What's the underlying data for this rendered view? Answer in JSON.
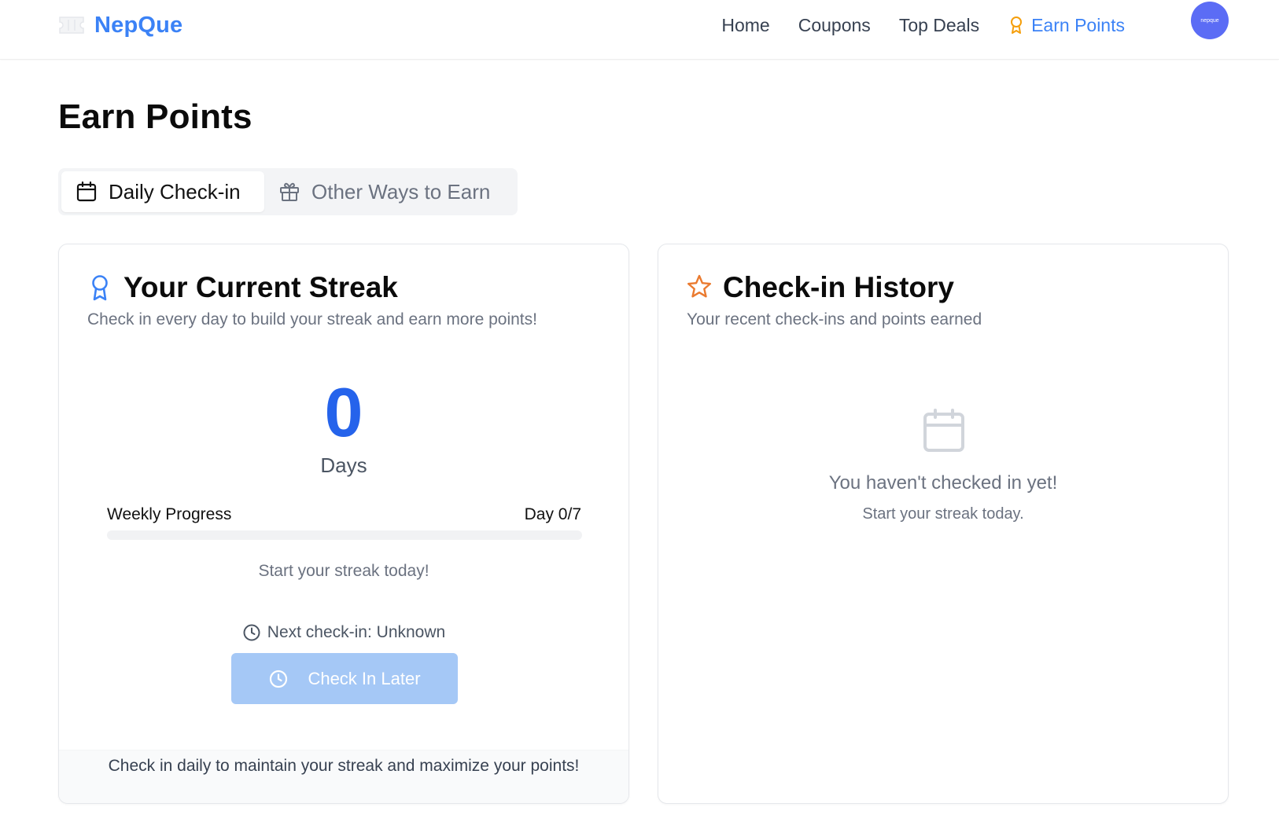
{
  "header": {
    "brand": "NepQue",
    "brand_icon": "ticket-icon",
    "nav": [
      {
        "label": "Home",
        "active": false
      },
      {
        "label": "Coupons",
        "active": false
      },
      {
        "label": "Top Deals",
        "active": false
      },
      {
        "label": "Earn Points",
        "active": true,
        "icon": "award-icon"
      }
    ],
    "avatar_text": "nepque"
  },
  "page": {
    "title": "Earn Points"
  },
  "tabs": [
    {
      "label": "Daily Check-in",
      "icon": "calendar-icon",
      "active": true
    },
    {
      "label": "Other Ways to Earn",
      "icon": "gift-icon",
      "active": false
    }
  ],
  "streak_card": {
    "title": "Your Current Streak",
    "icon": "award-icon",
    "description": "Check in every day to build your streak and earn more points!",
    "streak_value": "0",
    "streak_unit": "Days",
    "progress_label": "Weekly Progress",
    "progress_count": "Day 0/7",
    "progress_fraction": 0,
    "message": "Start your streak today!",
    "next_checkin": "Next check-in: Unknown",
    "button_label": "Check In Later",
    "footer": "Check in daily to maintain your streak and maximize your points!"
  },
  "history_card": {
    "title": "Check-in History",
    "icon": "star-icon",
    "description": "Your recent check-ins and points earned",
    "empty_title": "You haven't checked in yet!",
    "empty_subtitle": "Start your streak today."
  },
  "colors": {
    "accent": "#3b82f6",
    "streak_number": "#2563eb",
    "award_orange": "#f59e0b",
    "star_orange": "#ea7a2f",
    "button_disabled": "#a5c8f6",
    "avatar": "#5b6cf5"
  }
}
